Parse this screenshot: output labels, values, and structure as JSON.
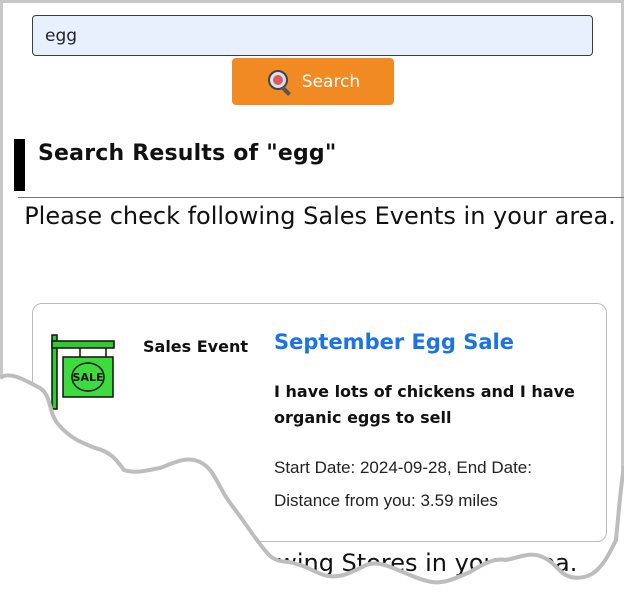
{
  "search": {
    "value": "egg",
    "button_label": "Search",
    "button_icon": "search-icon"
  },
  "results": {
    "title": "Search Results of \"egg\"",
    "notice": "Please check following Sales Events in your area."
  },
  "event": {
    "icon": "sale-sign-icon",
    "icon_text": "SALE",
    "type": "Sales Event",
    "title": "September Egg Sale",
    "description": "I have lots of chickens and I have organic eggs to sell",
    "dates": "Start Date: 2024-09-28, End Date:",
    "distance": "Distance from you: 3.59 miles"
  },
  "stores_heading": "Please check following Stores in your area.",
  "colors": {
    "button": "#f28a24",
    "link": "#1a73e8",
    "input_bg": "#e8f0fe",
    "sale_green": "#3ddc3d"
  }
}
